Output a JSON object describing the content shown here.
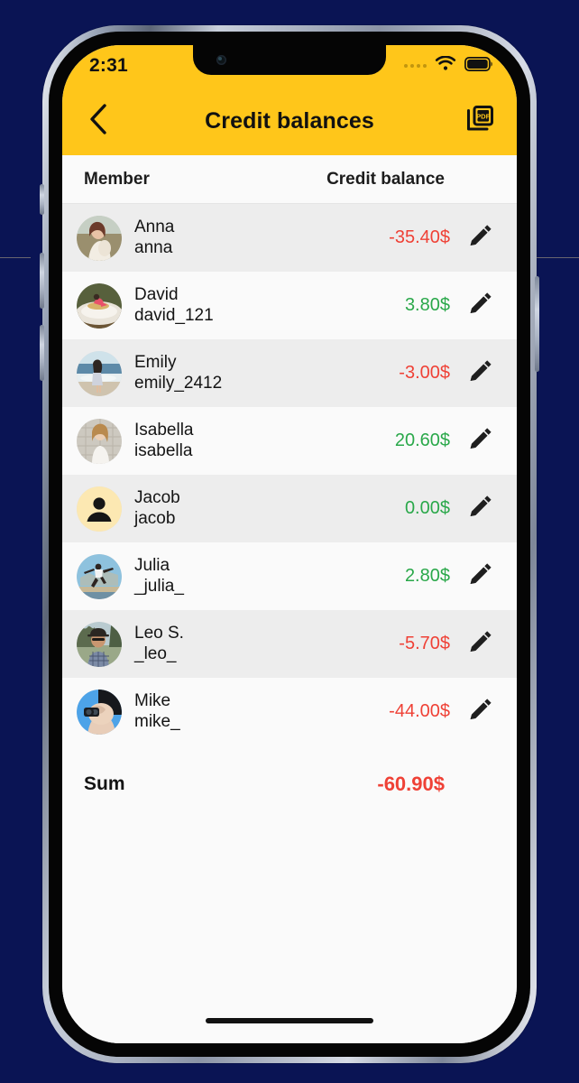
{
  "statusbar": {
    "clock": "2:31",
    "signal_icon": "signal-dots-icon",
    "wifi_icon": "wifi-icon",
    "battery_icon": "battery-icon"
  },
  "appbar": {
    "back_icon": "chevron-left-icon",
    "title": "Credit balances",
    "pdf_icon": "pdf-export-icon",
    "pdf_label": "PDF",
    "background": "#FFC61A"
  },
  "table": {
    "header": {
      "member": "Member",
      "balance": "Credit balance"
    },
    "rows": [
      {
        "name": "Anna",
        "handle": "anna",
        "balance": "-35.40$",
        "sign": "neg",
        "avatar": "photo-woman-field",
        "edit_icon": "pencil-icon"
      },
      {
        "name": "David",
        "handle": "david_121",
        "balance": "3.80$",
        "sign": "pos",
        "avatar": "photo-man-surf",
        "edit_icon": "pencil-icon"
      },
      {
        "name": "Emily",
        "handle": "emily_2412",
        "balance": "-3.00$",
        "sign": "neg",
        "avatar": "photo-woman-beach",
        "edit_icon": "pencil-icon"
      },
      {
        "name": "Isabella",
        "handle": "isabella",
        "balance": "20.60$",
        "sign": "pos",
        "avatar": "photo-woman-wall",
        "edit_icon": "pencil-icon"
      },
      {
        "name": "Jacob",
        "handle": "jacob",
        "balance": "0.00$",
        "sign": "pos",
        "avatar": "placeholder-person",
        "edit_icon": "pencil-icon"
      },
      {
        "name": "Julia",
        "handle": "_julia_",
        "balance": "2.80$",
        "sign": "pos",
        "avatar": "photo-woman-jump",
        "edit_icon": "pencil-icon"
      },
      {
        "name": "Leo S.",
        "handle": "_leo_",
        "balance": "-5.70$",
        "sign": "neg",
        "avatar": "photo-man-hat",
        "edit_icon": "pencil-icon"
      },
      {
        "name": "Mike",
        "handle": "mike_",
        "balance": "-44.00$",
        "sign": "neg",
        "avatar": "photo-man-camera",
        "edit_icon": "pencil-icon"
      }
    ],
    "sum": {
      "label": "Sum",
      "value": "-60.90$",
      "sign": "neg"
    }
  },
  "colors": {
    "accent": "#FFC61A",
    "negative": "#EF4136",
    "positive": "#2AA84A",
    "row_even": "#EDEDED",
    "row_odd": "#FAFAFA",
    "page_background": "#0A1454"
  }
}
